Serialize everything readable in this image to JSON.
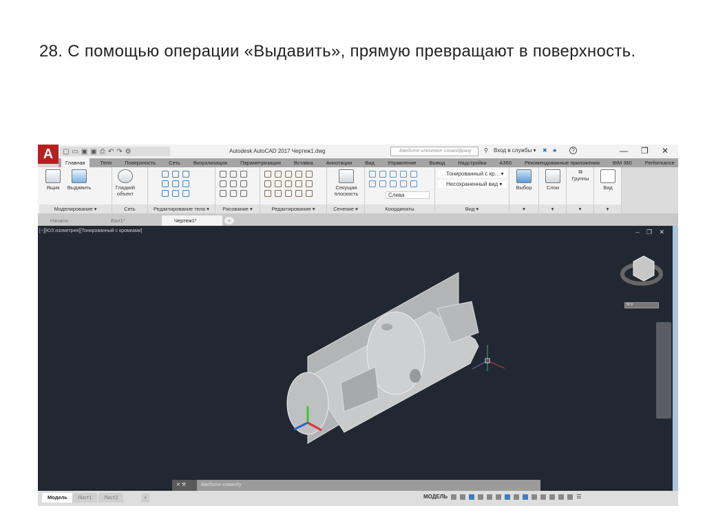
{
  "slide": {
    "title": "28. С помощью операции «Выдавить», прямую превращают в поверхность."
  },
  "app": {
    "title": "Autodesk AutoCAD 2017   Чертеж1.dwg",
    "logo": "A",
    "search_placeholder": "Введите ключевое слово/фразу",
    "signin": "Вход в службы ▾",
    "help": "?",
    "window_controls": [
      "—",
      "❐",
      "✕"
    ],
    "ribbon_tabs": [
      "Главная",
      "Тело",
      "Поверхность",
      "Сеть",
      "Визуализация",
      "Параметризация",
      "Вставка",
      "Аннотации",
      "Вид",
      "Управление",
      "Вывод",
      "Надстройки",
      "A360",
      "Рекомендованные приложения",
      "BIM 360",
      "Performance"
    ],
    "active_tab": 0,
    "panels": {
      "modeling": {
        "label": "Моделирование ▾",
        "box": "Ящик",
        "extrude": "Выдавить"
      },
      "mesh": {
        "label": "Сеть",
        "smooth": "Гладкий объект"
      },
      "solid_edit": {
        "label": "Редактирование тела ▾"
      },
      "draw": {
        "label": "Рисование ▾"
      },
      "modify": {
        "label": "Редактирование ▾"
      },
      "section": {
        "label": "Сечение ▾",
        "plane": "Секущая плоскость"
      },
      "coordinates": {
        "label": "Координаты",
        "view_select": "Слева"
      },
      "view": {
        "label": "Вид ▾",
        "visual_style": "Тонированный с кр... ▾",
        "named_view": "Несохраненный вид ▾"
      },
      "selection": {
        "label": "Выбор"
      },
      "layers": {
        "label": "Слои"
      },
      "groups": {
        "label": "Группы"
      },
      "view2": {
        "label": "Вид"
      }
    },
    "file_tabs": [
      "Начало",
      "Вал1*",
      "Чертеж1*",
      "+"
    ],
    "viewport": {
      "label": "[−][ЮЗ изометрия][Тонированный с кромками]",
      "controls": "– ❐ ✕",
      "wcs": "ВСК"
    },
    "command": {
      "placeholder": "Введите команду"
    },
    "layout_tabs": [
      "Модель",
      "Лист1",
      "Лист2",
      "+"
    ],
    "status": {
      "mode": "МОДЕЛЬ"
    }
  },
  "colors": {
    "logo": "#b52020",
    "viewport": "#222831",
    "accent": "#a9c6de"
  }
}
